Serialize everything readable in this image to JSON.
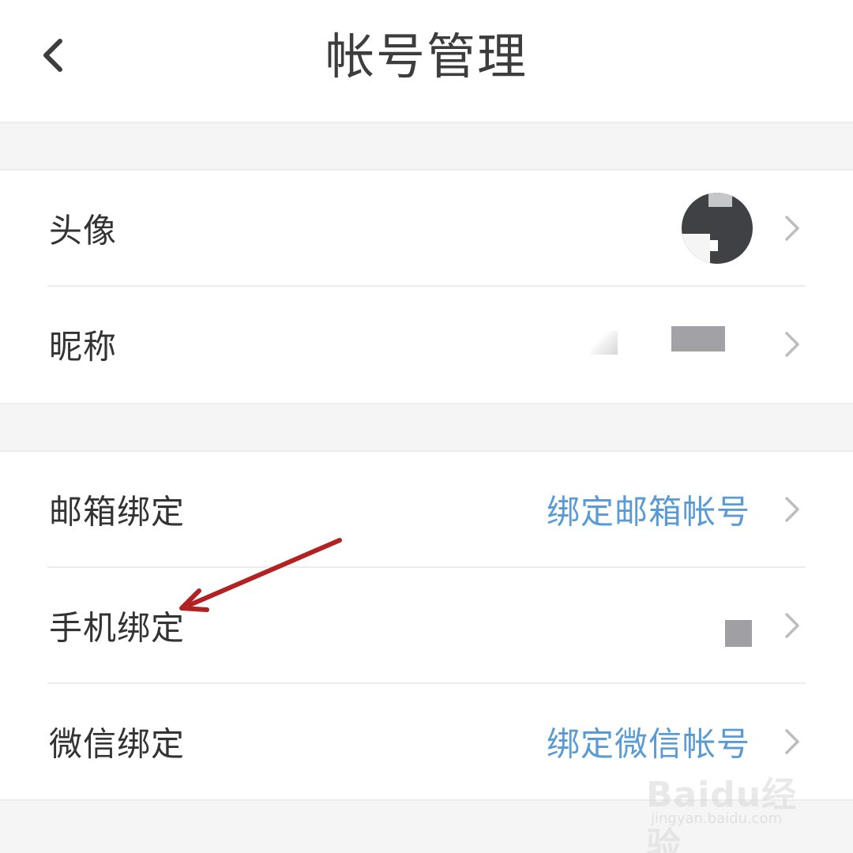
{
  "header": {
    "title": "帐号管理",
    "back_icon": "chevron-left-icon"
  },
  "profile_group": {
    "items": [
      {
        "label": "头像",
        "value_type": "avatar",
        "icon": "chevron-right-icon"
      },
      {
        "label": "昵称",
        "value_type": "redacted-text",
        "icon": "chevron-right-icon"
      }
    ]
  },
  "binding_group": {
    "items": [
      {
        "label": "邮箱绑定",
        "value": "绑定邮箱帐号",
        "icon": "chevron-right-icon"
      },
      {
        "label": "手机绑定",
        "value_type": "redacted-text",
        "icon": "chevron-right-icon"
      },
      {
        "label": "微信绑定",
        "value": "绑定微信帐号",
        "icon": "chevron-right-icon"
      }
    ]
  },
  "colors": {
    "link_blue": "#5b9bd5",
    "label_text": "#333333",
    "title_text": "#3d3d3d",
    "annotation_red": "#b22222",
    "background": "#f5f5f5"
  },
  "watermark": {
    "logo": "Baidu经验",
    "url": "jingyan.baidu.com"
  }
}
